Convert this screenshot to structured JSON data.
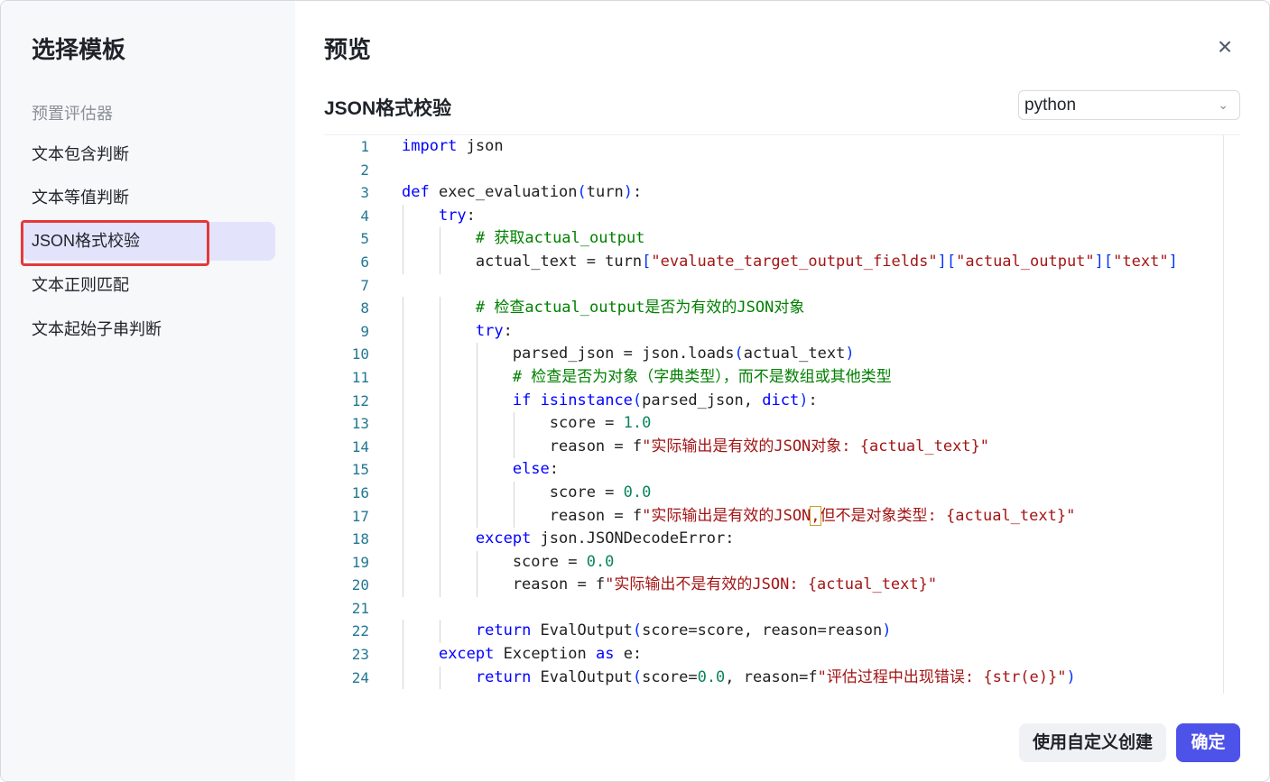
{
  "sidebar": {
    "title": "选择模板",
    "section": "预置评估器",
    "items": [
      {
        "label": "文本包含判断"
      },
      {
        "label": "文本等值判断"
      },
      {
        "label": "JSON格式校验",
        "active": true
      },
      {
        "label": "文本正则匹配"
      },
      {
        "label": "文本起始子串判断"
      }
    ]
  },
  "main": {
    "title": "预览",
    "close_icon": "×",
    "template_name": "JSON格式校验",
    "language": "python",
    "language_chevron": "⌄"
  },
  "footer": {
    "custom_label": "使用自定义创建",
    "ok_label": "确定"
  },
  "colors": {
    "accent": "#4d53e8",
    "active_item_bg": "#e3e4fb",
    "highlight_border": "#e5383b"
  },
  "code": {
    "line_numbers": [
      "1",
      "2",
      "3",
      "4",
      "5",
      "6",
      "7",
      "8",
      "9",
      "10",
      "11",
      "12",
      "13",
      "14",
      "15",
      "16",
      "17",
      "18",
      "19",
      "20",
      "21",
      "22",
      "23",
      "24"
    ],
    "lines": [
      [
        {
          "t": "import",
          "c": "kw"
        },
        {
          "t": " json"
        }
      ],
      [],
      [
        {
          "t": "def",
          "c": "kw"
        },
        {
          "t": " exec_evaluation"
        },
        {
          "t": "(",
          "c": "paren"
        },
        {
          "t": "turn"
        },
        {
          "t": ")",
          "c": "paren"
        },
        {
          "t": ":"
        }
      ],
      [
        {
          "t": "    "
        },
        {
          "t": "try",
          "c": "kw"
        },
        {
          "t": ":"
        }
      ],
      [
        {
          "t": "        "
        },
        {
          "t": "# 获取actual_output",
          "c": "cm"
        }
      ],
      [
        {
          "t": "        actual_text = turn"
        },
        {
          "t": "[",
          "c": "paren"
        },
        {
          "t": "\"evaluate_target_output_fields\"",
          "c": "str"
        },
        {
          "t": "][",
          "c": "paren"
        },
        {
          "t": "\"actual_output\"",
          "c": "str"
        },
        {
          "t": "][",
          "c": "paren"
        },
        {
          "t": "\"text\"",
          "c": "str"
        },
        {
          "t": "]",
          "c": "paren"
        }
      ],
      [],
      [
        {
          "t": "        "
        },
        {
          "t": "# 检查actual_output是否为有效的JSON对象",
          "c": "cm"
        }
      ],
      [
        {
          "t": "        "
        },
        {
          "t": "try",
          "c": "kw"
        },
        {
          "t": ":"
        }
      ],
      [
        {
          "t": "            parsed_json = json.loads"
        },
        {
          "t": "(",
          "c": "paren"
        },
        {
          "t": "actual_text"
        },
        {
          "t": ")",
          "c": "paren"
        }
      ],
      [
        {
          "t": "            "
        },
        {
          "t": "# 检查是否为对象（字典类型），而不是数组或其他类型",
          "c": "cm"
        }
      ],
      [
        {
          "t": "            "
        },
        {
          "t": "if",
          "c": "kw"
        },
        {
          "t": " "
        },
        {
          "t": "isinstance",
          "c": "kw"
        },
        {
          "t": "(",
          "c": "paren"
        },
        {
          "t": "parsed_json, "
        },
        {
          "t": "dict",
          "c": "kw"
        },
        {
          "t": ")",
          "c": "paren"
        },
        {
          "t": ":"
        }
      ],
      [
        {
          "t": "                score = "
        },
        {
          "t": "1.0",
          "c": "num"
        }
      ],
      [
        {
          "t": "                reason = f"
        },
        {
          "t": "\"实际输出是有效的JSON对象: {actual_text}\"",
          "c": "str"
        }
      ],
      [
        {
          "t": "            "
        },
        {
          "t": "else",
          "c": "kw"
        },
        {
          "t": ":"
        }
      ],
      [
        {
          "t": "                score = "
        },
        {
          "t": "0.0",
          "c": "num"
        }
      ],
      [
        {
          "t": "                reason = f"
        },
        {
          "t": "\"实际输出是有效的JSON",
          "c": "str"
        },
        {
          "t": ",",
          "c": "str box"
        },
        {
          "t": "但不是对象类型: {actual_text}\"",
          "c": "str"
        }
      ],
      [
        {
          "t": "        "
        },
        {
          "t": "except",
          "c": "kw"
        },
        {
          "t": " json.JSONDecodeError:"
        }
      ],
      [
        {
          "t": "            score = "
        },
        {
          "t": "0.0",
          "c": "num"
        }
      ],
      [
        {
          "t": "            reason = f"
        },
        {
          "t": "\"实际输出不是有效的JSON: {actual_text}\"",
          "c": "str"
        }
      ],
      [],
      [
        {
          "t": "        "
        },
        {
          "t": "return",
          "c": "kw"
        },
        {
          "t": " EvalOutput"
        },
        {
          "t": "(",
          "c": "paren"
        },
        {
          "t": "score=score, reason=reason"
        },
        {
          "t": ")",
          "c": "paren"
        }
      ],
      [
        {
          "t": "    "
        },
        {
          "t": "except",
          "c": "kw"
        },
        {
          "t": " Exception "
        },
        {
          "t": "as",
          "c": "kw"
        },
        {
          "t": " e:"
        }
      ],
      [
        {
          "t": "        "
        },
        {
          "t": "return",
          "c": "kw"
        },
        {
          "t": " EvalOutput"
        },
        {
          "t": "(",
          "c": "paren"
        },
        {
          "t": "score="
        },
        {
          "t": "0.0",
          "c": "num"
        },
        {
          "t": ", reason=f"
        },
        {
          "t": "\"评估过程中出现错误: {str(e)}\"",
          "c": "str"
        },
        {
          "t": ")",
          "c": "paren"
        }
      ]
    ]
  }
}
